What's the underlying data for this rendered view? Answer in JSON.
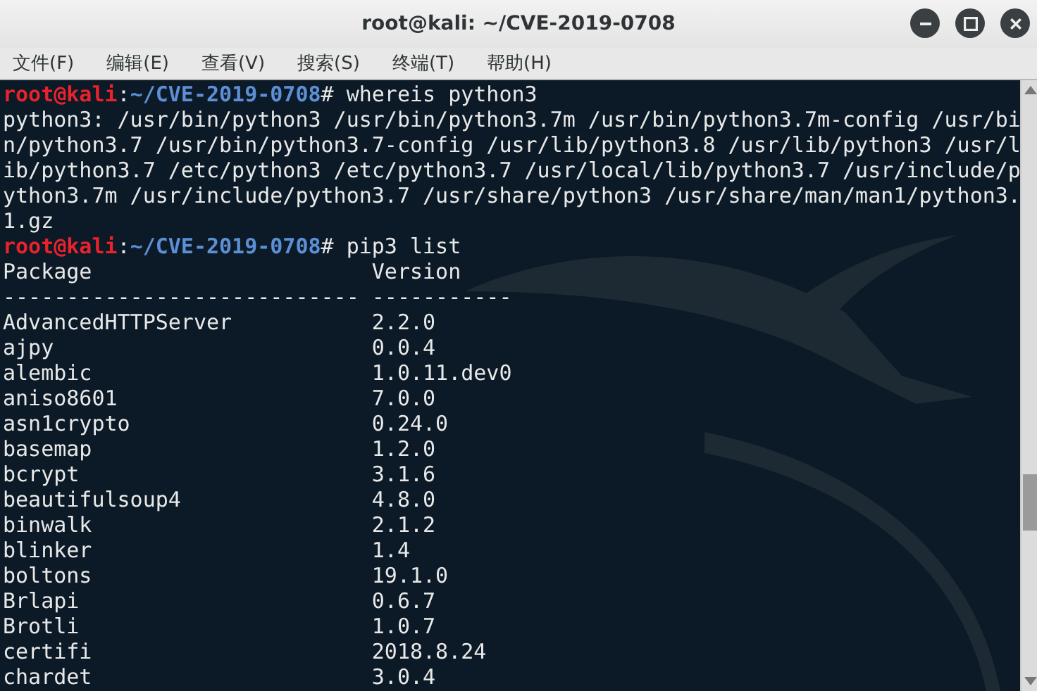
{
  "window": {
    "title": "root@kali: ~/CVE-2019-0708"
  },
  "menu": [
    "文件(F)",
    "编辑(E)",
    "查看(V)",
    "搜索(S)",
    "终端(T)",
    "帮助(H)"
  ],
  "terminal": {
    "lines": [
      {
        "kind": "prompt",
        "user": "root@kali",
        "separator": ":",
        "path": "~/CVE-2019-0708",
        "symbol": "#",
        "command": "whereis python3"
      },
      {
        "kind": "output",
        "text": "python3: /usr/bin/python3 /usr/bin/python3.7m /usr/bin/python3.7m-config /usr/bi"
      },
      {
        "kind": "output",
        "text": "n/python3.7 /usr/bin/python3.7-config /usr/lib/python3.8 /usr/lib/python3 /usr/l"
      },
      {
        "kind": "output",
        "text": "ib/python3.7 /etc/python3 /etc/python3.7 /usr/local/lib/python3.7 /usr/include/p"
      },
      {
        "kind": "output",
        "text": "ython3.7m /usr/include/python3.7 /usr/share/python3 /usr/share/man/man1/python3."
      },
      {
        "kind": "output",
        "text": "1.gz"
      },
      {
        "kind": "prompt",
        "user": "root@kali",
        "separator": ":",
        "path": "~/CVE-2019-0708",
        "symbol": "#",
        "command": "pip3 list"
      },
      {
        "kind": "row",
        "package": "Package",
        "version": "Version"
      },
      {
        "kind": "row",
        "package": "----------------------------",
        "version": "-----------"
      },
      {
        "kind": "row",
        "package": "AdvancedHTTPServer",
        "version": "2.2.0"
      },
      {
        "kind": "row",
        "package": "ajpy",
        "version": "0.0.4"
      },
      {
        "kind": "row",
        "package": "alembic",
        "version": "1.0.11.dev0"
      },
      {
        "kind": "row",
        "package": "aniso8601",
        "version": "7.0.0"
      },
      {
        "kind": "row",
        "package": "asn1crypto",
        "version": "0.24.0"
      },
      {
        "kind": "row",
        "package": "basemap",
        "version": "1.2.0"
      },
      {
        "kind": "row",
        "package": "bcrypt",
        "version": "3.1.6"
      },
      {
        "kind": "row",
        "package": "beautifulsoup4",
        "version": "4.8.0"
      },
      {
        "kind": "row",
        "package": "binwalk",
        "version": "2.1.2"
      },
      {
        "kind": "row",
        "package": "blinker",
        "version": "1.4"
      },
      {
        "kind": "row",
        "package": "boltons",
        "version": "19.1.0"
      },
      {
        "kind": "row",
        "package": "Brlapi",
        "version": "0.6.7"
      },
      {
        "kind": "row",
        "package": "Brotli",
        "version": "1.0.7"
      },
      {
        "kind": "row",
        "package": "certifi",
        "version": "2018.8.24"
      },
      {
        "kind": "row",
        "package": "chardet",
        "version": "3.0.4"
      }
    ]
  }
}
